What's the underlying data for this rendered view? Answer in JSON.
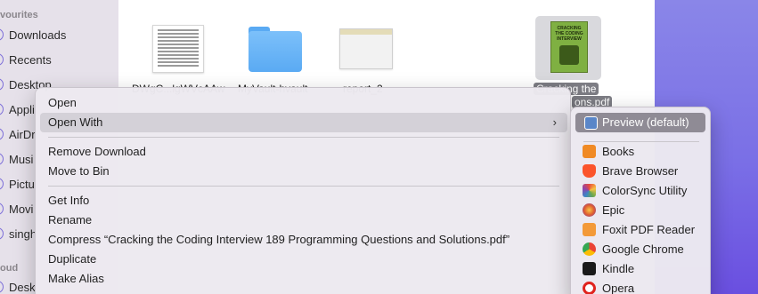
{
  "sidebar": {
    "section_favourites": "vourites",
    "section_cloud": "oud",
    "items": [
      {
        "label": "Downloads"
      },
      {
        "label": "Recents"
      },
      {
        "label": "Desktop"
      },
      {
        "label": "Appli"
      },
      {
        "label": "AirDr"
      },
      {
        "label": "Musi"
      },
      {
        "label": "Pictu"
      },
      {
        "label": "Movi"
      },
      {
        "label": "singh"
      }
    ],
    "cloud_items": [
      {
        "label": "Desk"
      }
    ]
  },
  "files": {
    "items": [
      {
        "name": "DWgC...lgWVcAAw",
        "icon": "document-icon"
      },
      {
        "name": "MyVault-hvault",
        "icon": "folder-icon"
      },
      {
        "name": "report_2",
        "icon": "spreadsheet-icon"
      }
    ],
    "selected": {
      "name_line1": "Cracking the",
      "name_line2": "ons.pdf",
      "cover_text": "CRACKING THE CODING INTERVIEW",
      "icon": "pdf-book-icon"
    }
  },
  "menu": {
    "open": "Open",
    "open_with": "Open With",
    "chevron": "›",
    "remove_download": "Remove Download",
    "move_to_bin": "Move to Bin",
    "get_info": "Get Info",
    "rename": "Rename",
    "compress": "Compress “Cracking the Coding Interview 189 Programming Questions and Solutions.pdf”",
    "duplicate": "Duplicate",
    "make_alias": "Make Alias"
  },
  "submenu": {
    "default_app": "Preview (default)",
    "apps": [
      {
        "label": "Books",
        "icon": "books-icon",
        "color": "#f08a24"
      },
      {
        "label": "Brave Browser",
        "icon": "brave-icon",
        "color": "#fb542b"
      },
      {
        "label": "ColorSync Utility",
        "icon": "colorsync-icon",
        "color": "#6aa84f"
      },
      {
        "label": "Epic",
        "icon": "epic-icon",
        "color": "#e06030"
      },
      {
        "label": "Foxit PDF Reader",
        "icon": "foxit-icon",
        "color": "#f39a38"
      },
      {
        "label": "Google Chrome",
        "icon": "chrome-icon",
        "color": "#4285f4"
      },
      {
        "label": "Kindle",
        "icon": "kindle-icon",
        "color": "#1a1a1a"
      },
      {
        "label": "Opera",
        "icon": "opera-icon",
        "color": "#e0241e"
      }
    ]
  },
  "colors": {
    "accent": "#7d6fd9",
    "highlight": "#8f8b95"
  }
}
